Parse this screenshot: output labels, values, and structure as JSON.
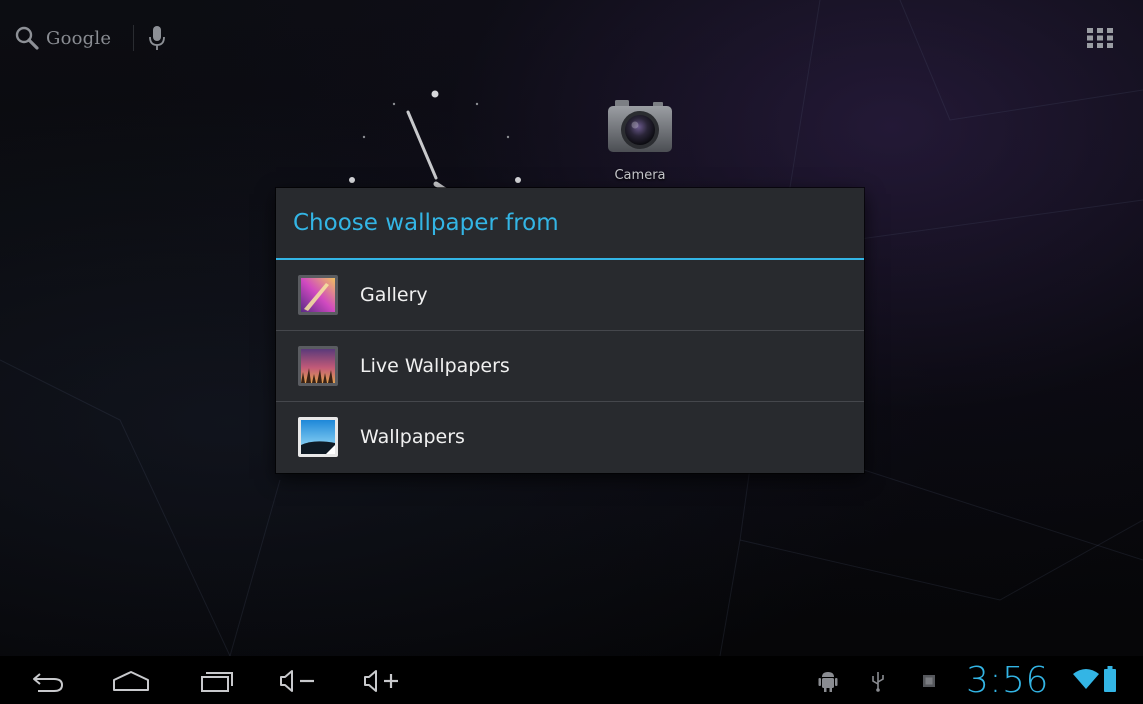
{
  "home": {
    "search_label": "Google",
    "camera_label": "Camera"
  },
  "dialog": {
    "title": "Choose wallpaper from",
    "items": [
      {
        "label": "Gallery",
        "icon": "gallery-icon"
      },
      {
        "label": "Live Wallpapers",
        "icon": "live-wallpapers-icon"
      },
      {
        "label": "Wallpapers",
        "icon": "wallpapers-icon"
      }
    ]
  },
  "status_bar": {
    "time": "3:56"
  },
  "colors": {
    "accent": "#33b5e5",
    "dialog_bg": "#282a2e",
    "navbar_bg": "#000000"
  },
  "icons": {
    "nav": [
      "back-icon",
      "home-icon",
      "recent-apps-icon",
      "volume-down-icon",
      "volume-up-icon"
    ],
    "status": [
      "android-debug-icon",
      "usb-icon",
      "notification-icon",
      "wifi-icon",
      "battery-icon"
    ]
  }
}
